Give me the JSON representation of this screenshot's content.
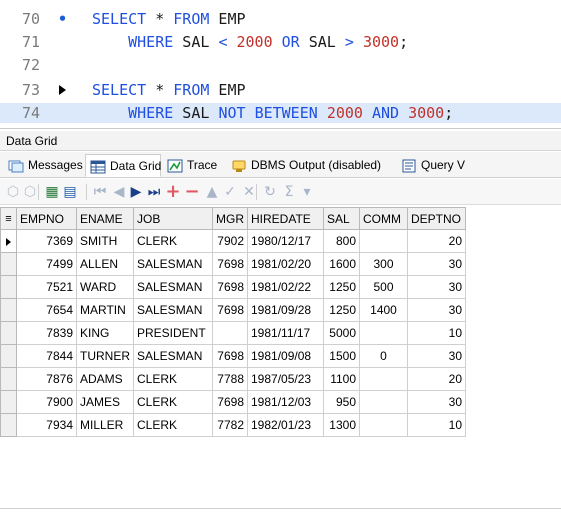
{
  "editor": {
    "lines": [
      {
        "num": "70",
        "marker": "fold",
        "tokens": [
          {
            "t": "SELECT",
            "c": "kw"
          },
          {
            "t": " * ",
            "c": "plain"
          },
          {
            "t": "FROM",
            "c": "kw"
          },
          {
            "t": " EMP",
            "c": "tbl"
          }
        ]
      },
      {
        "num": "71",
        "marker": "",
        "tokens": [
          {
            "t": "    WHERE",
            "c": "kw"
          },
          {
            "t": " SAL ",
            "c": "plain"
          },
          {
            "t": "<",
            "c": "op"
          },
          {
            "t": " ",
            "c": "plain"
          },
          {
            "t": "2000",
            "c": "num"
          },
          {
            "t": " ",
            "c": "plain"
          },
          {
            "t": "OR",
            "c": "kw"
          },
          {
            "t": " SAL ",
            "c": "plain"
          },
          {
            "t": ">",
            "c": "op"
          },
          {
            "t": " ",
            "c": "plain"
          },
          {
            "t": "3000",
            "c": "num"
          },
          {
            "t": ";",
            "c": "plain"
          }
        ]
      },
      {
        "num": "72",
        "marker": "",
        "tokens": []
      },
      {
        "num": "73",
        "marker": "exec",
        "tokens": [
          {
            "t": "SELECT",
            "c": "kw"
          },
          {
            "t": " * ",
            "c": "plain"
          },
          {
            "t": "FROM",
            "c": "kw"
          },
          {
            "t": " EMP",
            "c": "tbl"
          }
        ]
      },
      {
        "num": "74",
        "marker": "",
        "current": true,
        "tokens": [
          {
            "t": "    WHERE",
            "c": "kw"
          },
          {
            "t": " SAL ",
            "c": "plain"
          },
          {
            "t": "NOT",
            "c": "kw"
          },
          {
            "t": " ",
            "c": "plain"
          },
          {
            "t": "BETWEEN",
            "c": "kw"
          },
          {
            "t": " ",
            "c": "plain"
          },
          {
            "t": "2000",
            "c": "num"
          },
          {
            "t": " ",
            "c": "plain"
          },
          {
            "t": "AND",
            "c": "kw"
          },
          {
            "t": " ",
            "c": "plain"
          },
          {
            "t": "3000",
            "c": "num"
          },
          {
            "t": ";",
            "c": "plain"
          }
        ]
      }
    ]
  },
  "panel": {
    "title": "Data Grid"
  },
  "tabs": [
    {
      "label": "Messages",
      "icon": "messages-icon",
      "active": false
    },
    {
      "label": "Data Grid",
      "icon": "data-grid-icon",
      "active": true
    },
    {
      "label": "Trace",
      "icon": "trace-icon",
      "active": false
    },
    {
      "label": "DBMS Output (disabled)",
      "icon": "dbms-output-icon",
      "active": false
    },
    {
      "label": "Query V",
      "icon": "query-viewer-icon",
      "active": false
    }
  ],
  "toolbar": {
    "buttons": [
      {
        "name": "export-icon",
        "glyph": "⬡"
      },
      {
        "name": "import-icon",
        "glyph": "⬡"
      },
      {
        "name": "grid-view-icon",
        "glyph": "▦"
      },
      {
        "name": "record-view-icon",
        "glyph": "▤"
      },
      {
        "name": "first-record-icon",
        "glyph": "⏮"
      },
      {
        "name": "prior-record-icon",
        "glyph": "◀"
      },
      {
        "name": "next-record-icon",
        "glyph": "▶"
      },
      {
        "name": "last-record-icon",
        "glyph": "⏭"
      },
      {
        "name": "insert-record-icon",
        "glyph": "+"
      },
      {
        "name": "delete-record-icon",
        "glyph": "−"
      },
      {
        "name": "edit-record-icon",
        "glyph": "▲"
      },
      {
        "name": "post-edit-icon",
        "glyph": "✓"
      },
      {
        "name": "cancel-edit-icon",
        "glyph": "✕"
      },
      {
        "name": "refresh-icon",
        "glyph": "↻"
      },
      {
        "name": "sum-icon",
        "glyph": "Σ"
      },
      {
        "name": "dropdown-icon",
        "glyph": "▾"
      }
    ]
  },
  "grid": {
    "columns": [
      "EMPNO",
      "ENAME",
      "JOB",
      "MGR",
      "HIREDATE",
      "SAL",
      "COMM",
      "DEPTNO"
    ],
    "rows": [
      [
        "7369",
        "SMITH",
        "CLERK",
        "7902",
        "1980/12/17",
        "800",
        "",
        "20"
      ],
      [
        "7499",
        "ALLEN",
        "SALESMAN",
        "7698",
        "1981/02/20",
        "1600",
        "300",
        "30"
      ],
      [
        "7521",
        "WARD",
        "SALESMAN",
        "7698",
        "1981/02/22",
        "1250",
        "500",
        "30"
      ],
      [
        "7654",
        "MARTIN",
        "SALESMAN",
        "7698",
        "1981/09/28",
        "1250",
        "1400",
        "30"
      ],
      [
        "7839",
        "KING",
        "PRESIDENT",
        "",
        "1981/11/17",
        "5000",
        "",
        "10"
      ],
      [
        "7844",
        "TURNER",
        "SALESMAN",
        "7698",
        "1981/09/08",
        "1500",
        "0",
        "30"
      ],
      [
        "7876",
        "ADAMS",
        "CLERK",
        "7788",
        "1987/05/23",
        "1100",
        "",
        "20"
      ],
      [
        "7900",
        "JAMES",
        "CLERK",
        "7698",
        "1981/12/03",
        "950",
        "",
        "30"
      ],
      [
        "7934",
        "MILLER",
        "CLERK",
        "7782",
        "1982/01/23",
        "1300",
        "",
        "10"
      ]
    ]
  },
  "colors": {
    "keyword": "#1f4fe0",
    "number": "#c0322a",
    "current_line": "#dbe9fb"
  }
}
